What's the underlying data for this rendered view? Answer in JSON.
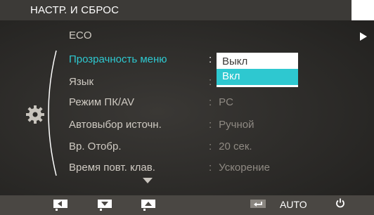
{
  "header": {
    "title": "НАСТР. И СБРОС"
  },
  "menu": {
    "items": [
      {
        "label": "ECO",
        "value": ""
      },
      {
        "label": "Прозрачность меню",
        "value": ""
      },
      {
        "label": "Язык",
        "value": ""
      },
      {
        "label": "Режим ПК/AV",
        "value": "PC"
      },
      {
        "label": "Автовыбор источн.",
        "value": "Ручной"
      },
      {
        "label": "Вр. Отобр.",
        "value": "20 сек."
      },
      {
        "label": "Время повт. клав.",
        "value": "Ускорение"
      }
    ],
    "separator": ":"
  },
  "dropdown": {
    "options": [
      "Выкл",
      "Вкл"
    ],
    "selected": "Вкл"
  },
  "bottom_bar": {
    "auto_label": "AUTO"
  },
  "colors": {
    "highlight": "#2ec8d0",
    "title_bar": "#3c3a37",
    "panel": "#2f2d2b"
  }
}
